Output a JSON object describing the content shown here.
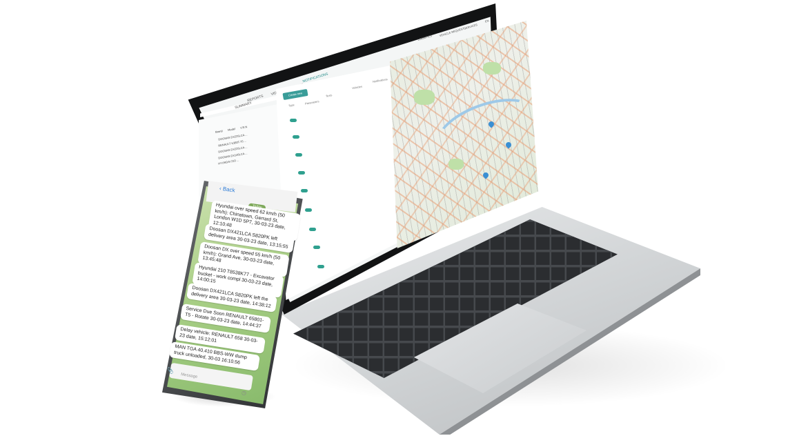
{
  "laptop": {
    "nav": {
      "summary": "SUMMARY",
      "reports": "REPORTS",
      "video_monitoring": "VIDEO MONITORING",
      "notifications": "NOTIFICATIONS"
    },
    "top_links": [
      "LOGISTICS",
      "VEHICLE REQUEST",
      "SERVICES",
      "EN"
    ],
    "left_panel": {
      "columns": [
        "Brand",
        "Model",
        "V.R.N"
      ],
      "rows": [
        "DOOSAN  DX225LCA  ...",
        "RENAULT  K380T-T5  ...",
        "DOOSAN  DX225LCA  ...",
        "DOOSAN  DX140LCA  ...",
        "HYUNDAI  210  ..."
      ]
    },
    "notifications": {
      "create_button": "Create new",
      "columns": [
        "Type",
        "Parameters",
        "Texts",
        "Vehicles",
        "Notifications"
      ]
    }
  },
  "phone": {
    "back_label": "Back",
    "date_chip": "Today",
    "messages": [
      "Hyundai over speed 62 km/h (50 km/h): Chinatown, Gerrard St, London W1D 5P7, 30-03-23 date, 12:10:48",
      "Doosan DX421LCA S820PK left delivery area 30-03-23 date, 13:15:55",
      "Doosan DX over speed 55 km/h (50 km/h): Grand Ave, 30-03-23 date, 13:45:48",
      "Hyundai 210 T8538K77 - Excavator bucket - work compl 30-03-23 date, 14:00:15",
      "Doosan DX421LCA S820PK left the delivery area 30-03-23 date, 14:38:12",
      "Service Due Soon RENAULT 65801-T5 - Rotate 30-03-23 date, 14:44:37",
      "Delay vehicle: RENAULT 658 30-03-23 date, 15:12:01",
      "MAN TGA 40.410 BBS-WW dump truck unloaded, 30-03 16:10:56"
    ],
    "input_placeholder": "Message"
  }
}
